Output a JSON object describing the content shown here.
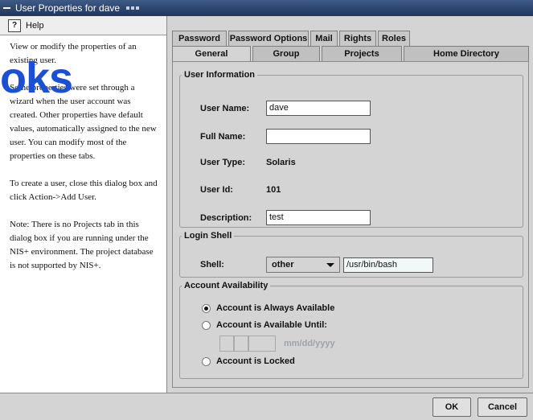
{
  "window": {
    "title": "User Properties for dave"
  },
  "help": {
    "title": "Help",
    "watermark": "oks",
    "paragraphs": [
      "View or modify the properties of an existing user.",
      "Some properties were set through a wizard when the user account was created. Other properties have default values, automatically assigned to the new user. You can modify most of the properties on these tabs.",
      "To create a user, close this dialog box and click Action->Add User.",
      "Note: There is no Projects tab in this dialog box if you are running under the NIS+ environment. The project database is not supported by NIS+."
    ]
  },
  "tabs": {
    "back": [
      "Password",
      "Password Options",
      "Mail",
      "Rights",
      "Roles"
    ],
    "front": [
      "General",
      "Group",
      "Projects",
      "Home Directory"
    ],
    "active": "General"
  },
  "user_info": {
    "legend": "User Information",
    "user_name_label": "User Name:",
    "user_name_value": "dave",
    "full_name_label": "Full Name:",
    "full_name_value": "",
    "user_type_label": "User Type:",
    "user_type_value": "Solaris",
    "user_id_label": "User Id:",
    "user_id_value": "101",
    "description_label": "Description:",
    "description_value": "test"
  },
  "login_shell": {
    "legend": "Login Shell",
    "shell_label": "Shell:",
    "shell_selected": "other",
    "shell_path": "/usr/bin/bash"
  },
  "availability": {
    "legend": "Account Availability",
    "always": "Account is Always Available",
    "until": "Account is Available Until:",
    "date_placeholder": "mm/dd/yyyy",
    "locked": "Account is Locked",
    "selected": "always"
  },
  "buttons": {
    "ok": "OK",
    "cancel": "Cancel"
  }
}
